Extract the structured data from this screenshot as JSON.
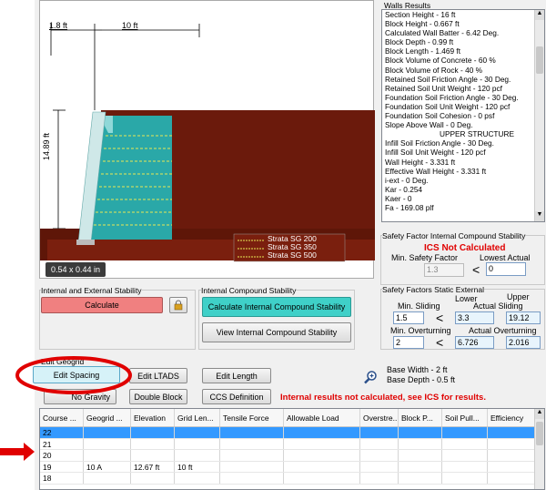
{
  "drawing": {
    "dim_left": "1.8 ft",
    "dim_top": "10 ft",
    "dim_height": "14.89 ft",
    "size_readout": "0.54 x 0.44 in",
    "legend": [
      "Strata SG 200",
      "Strata SG 350",
      "Strata SG 500"
    ]
  },
  "walls_results": {
    "title": "Walls Results",
    "lines": [
      "Section Height - 16 ft",
      "Block Height - 0.667 ft",
      "Calculated Wall Batter - 6.42 Deg.",
      "Block Depth - 0.99 ft",
      "Block Length - 1.469 ft",
      "Block Volume of Concrete - 60 %",
      "Block Volume of Rock - 40 %",
      "Retained Soil Friction Angle - 30 Deg.",
      "Retained Soil Unit Weight - 120 pcf",
      "Foundation Soil Friction Angle - 30 Deg.",
      "Foundation Soil Unit Weight - 120 pcf",
      "Foundation Soil Cohesion - 0 psf",
      "Slope Above Wall - 0 Deg.",
      "UPPER STRUCTURE",
      "Infill Soil Friction Angle - 30 Deg.",
      "Infill Soil Unit Weight - 120 pcf",
      "Wall Height - 3.331 ft",
      "Effective Wall Height - 3.331 ft",
      "i-ext - 0 Deg.",
      "Kar - 0.254",
      "Kaer - 0",
      "Fa - 169.08 plf"
    ]
  },
  "ics": {
    "title": "Safety Factor Internal Compound Stability",
    "status": "ICS Not Calculated",
    "min_label": "Min. Safety Factor",
    "lowest_label": "Lowest Actual",
    "min_value": "1.3",
    "lowest_value": "0"
  },
  "static": {
    "title": "Safety Factors Static External",
    "lower_label": "Lower",
    "upper_label": "Upper",
    "min_sliding_label": "Min. Sliding",
    "actual_sliding_label": "Actual Sliding",
    "min_sliding": "1.5",
    "lt": "<",
    "sliding_lower": "3.3",
    "sliding_upper": "19.12",
    "min_overturning_label": "Min. Overturning",
    "actual_overturning_label": "Actual Overturning",
    "min_overturning": "2",
    "overturning_lower": "6.726",
    "overturning_upper": "2.016"
  },
  "internal": {
    "title": "Internal and External Stability",
    "calculate": "Calculate"
  },
  "compound": {
    "title": "Internal Compound Stability",
    "calculate": "Calculate Internal Compound Stability",
    "view": "View Internal Compound Stability"
  },
  "geogrid": {
    "title": "Edit Geogrid",
    "edit_spacing": "Edit Spacing",
    "edit_ltads": "Edit LTADS",
    "edit_length": "Edit Length",
    "no_gravity": "No Gravity",
    "double_block": "Double Block",
    "ccs_definition": "CCS Definition"
  },
  "base": {
    "width": "Base Width - 2 ft",
    "depth": "Base Depth - 0.5 ft"
  },
  "warning": "Internal results not calculated, see ICS for results.",
  "table": {
    "headers": [
      "Course ...",
      "Geogrid ...",
      "Elevation",
      "Grid Len...",
      "Tensile Force",
      "Allowable Load",
      "Overstre...",
      "Block P...",
      "Soil Pull...",
      "Efficiency"
    ],
    "rows": [
      [
        "22",
        "",
        "",
        "",
        "",
        "",
        "",
        "",
        "",
        ""
      ],
      [
        "21",
        "",
        "",
        "",
        "",
        "",
        "",
        "",
        "",
        ""
      ],
      [
        "20",
        "",
        "",
        "",
        "",
        "",
        "",
        "",
        "",
        ""
      ],
      [
        "19",
        "10 A",
        "12.67 ft",
        "10 ft",
        "",
        "",
        "",
        "",
        "",
        ""
      ],
      [
        "18",
        "",
        "",
        "",
        "",
        "",
        "",
        "",
        "",
        ""
      ]
    ]
  },
  "colors": {
    "soil": "#6b1a0c",
    "calculate_button": "#f08080",
    "teal_button": "#3fd0c8",
    "annotation_red": "#e00000"
  }
}
